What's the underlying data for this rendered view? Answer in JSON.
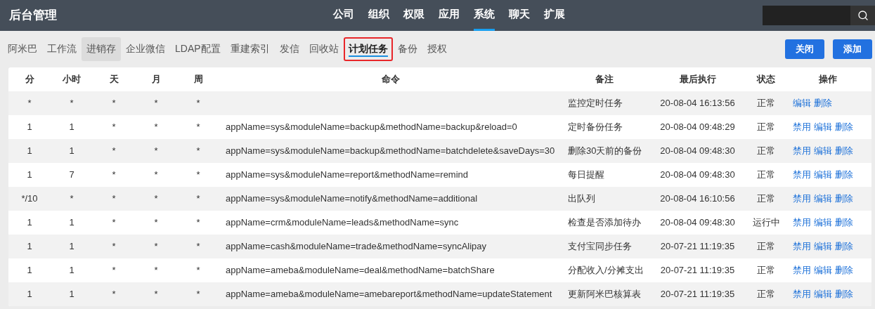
{
  "header": {
    "title": "后台管理",
    "nav": [
      {
        "label": "公司",
        "selected": false
      },
      {
        "label": "组织",
        "selected": false
      },
      {
        "label": "权限",
        "selected": false
      },
      {
        "label": "应用",
        "selected": false
      },
      {
        "label": "系统",
        "selected": true
      },
      {
        "label": "聊天",
        "selected": false
      },
      {
        "label": "扩展",
        "selected": false
      }
    ]
  },
  "tabs": [
    {
      "label": "阿米巴",
      "selected": false,
      "hovered": false,
      "highlighted": false
    },
    {
      "label": "工作流",
      "selected": false,
      "hovered": false,
      "highlighted": false
    },
    {
      "label": "进销存",
      "selected": false,
      "hovered": true,
      "highlighted": false
    },
    {
      "label": "企业微信",
      "selected": false,
      "hovered": false,
      "highlighted": false
    },
    {
      "label": "LDAP配置",
      "selected": false,
      "hovered": false,
      "highlighted": false
    },
    {
      "label": "重建索引",
      "selected": false,
      "hovered": false,
      "highlighted": false
    },
    {
      "label": "发信",
      "selected": false,
      "hovered": false,
      "highlighted": false
    },
    {
      "label": "回收站",
      "selected": false,
      "hovered": false,
      "highlighted": false
    },
    {
      "label": "计划任务",
      "selected": true,
      "hovered": false,
      "highlighted": true
    },
    {
      "label": "备份",
      "selected": false,
      "hovered": false,
      "highlighted": false
    },
    {
      "label": "授权",
      "selected": false,
      "hovered": false,
      "highlighted": false
    }
  ],
  "buttons": [
    "关闭",
    "添加"
  ],
  "table": {
    "columns": [
      "分",
      "小时",
      "天",
      "月",
      "周",
      "命令",
      "备注",
      "最后执行",
      "状态",
      "操作"
    ],
    "rows": [
      {
        "cells": [
          "*",
          "*",
          "*",
          "*",
          "*",
          "",
          "监控定时任务",
          "20-08-04 16:13:56",
          "正常"
        ],
        "actions": [
          "编辑",
          "删除"
        ]
      },
      {
        "cells": [
          "1",
          "1",
          "*",
          "*",
          "*",
          "appName=sys&moduleName=backup&methodName=backup&reload=0",
          "定时备份任务",
          "20-08-04 09:48:29",
          "正常"
        ],
        "actions": [
          "禁用",
          "编辑",
          "删除"
        ]
      },
      {
        "cells": [
          "1",
          "1",
          "*",
          "*",
          "*",
          "appName=sys&moduleName=backup&methodName=batchdelete&saveDays=30",
          "删除30天前的备份",
          "20-08-04 09:48:30",
          "正常"
        ],
        "actions": [
          "禁用",
          "编辑",
          "删除"
        ]
      },
      {
        "cells": [
          "1",
          "7",
          "*",
          "*",
          "*",
          "appName=sys&moduleName=report&methodName=remind",
          "每日提醒",
          "20-08-04 09:48:30",
          "正常"
        ],
        "actions": [
          "禁用",
          "编辑",
          "删除"
        ]
      },
      {
        "cells": [
          "*/10",
          "*",
          "*",
          "*",
          "*",
          "appName=sys&moduleName=notify&methodName=additional",
          "出队列",
          "20-08-04 16:10:56",
          "正常"
        ],
        "actions": [
          "禁用",
          "编辑",
          "删除"
        ]
      },
      {
        "cells": [
          "1",
          "1",
          "*",
          "*",
          "*",
          "appName=crm&moduleName=leads&methodName=sync",
          "检查是否添加待办",
          "20-08-04 09:48:30",
          "运行中"
        ],
        "actions": [
          "禁用",
          "编辑",
          "删除"
        ]
      },
      {
        "cells": [
          "1",
          "1",
          "*",
          "*",
          "*",
          "appName=cash&moduleName=trade&methodName=syncAlipay",
          "支付宝同步任务",
          "20-07-21 11:19:35",
          "正常"
        ],
        "actions": [
          "禁用",
          "编辑",
          "删除"
        ]
      },
      {
        "cells": [
          "1",
          "1",
          "*",
          "*",
          "*",
          "appName=ameba&moduleName=deal&methodName=batchShare",
          "分配收入/分摊支出",
          "20-07-21 11:19:35",
          "正常"
        ],
        "actions": [
          "禁用",
          "编辑",
          "删除"
        ]
      },
      {
        "cells": [
          "1",
          "1",
          "*",
          "*",
          "*",
          "appName=ameba&moduleName=amebareport&methodName=updateStatement",
          "更新阿米巴核算表",
          "20-07-21 11:19:35",
          "正常"
        ],
        "actions": [
          "禁用",
          "编辑",
          "删除"
        ]
      }
    ]
  }
}
